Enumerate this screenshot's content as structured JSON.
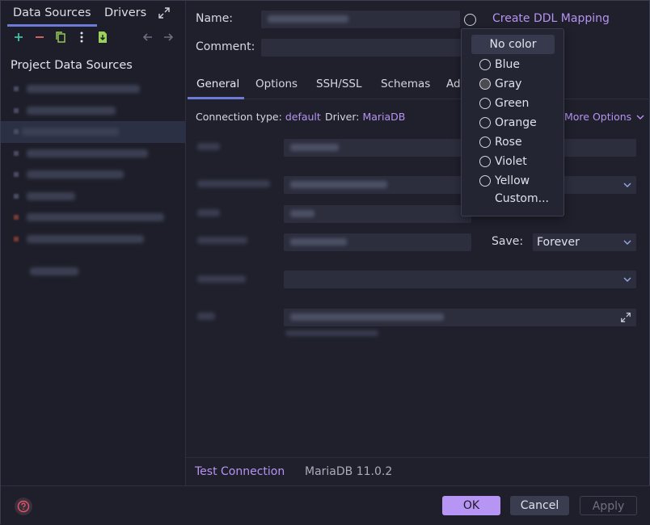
{
  "left_panel": {
    "tabs": [
      {
        "label": "Data Sources"
      },
      {
        "label": "Drivers"
      }
    ],
    "project_title": "Project Data Sources",
    "tree_rows": [
      {
        "w": 140
      },
      {
        "w": 110
      },
      {
        "w": 120
      },
      {
        "w": 150
      },
      {
        "w": 120
      },
      {
        "w": 60
      },
      {
        "w": 160
      },
      {
        "w": 140
      }
    ],
    "problems_row": {
      "w": 60
    }
  },
  "form": {
    "name_label": "Name:",
    "comment_label": "Comment:",
    "ddl_link": "Create DDL Mapping",
    "subtabs": [
      "General",
      "Options",
      "SSH/SSL",
      "Schemas",
      "Ad"
    ],
    "connection_type_label": "Connection type:",
    "connection_type_value": "default",
    "driver_label": "Driver:",
    "driver_value": "MariaDB",
    "more_options": "More Options",
    "save_label": "Save:",
    "save_value": "Forever"
  },
  "color_menu": {
    "no_color": "No color",
    "items": [
      "Blue",
      "Gray",
      "Green",
      "Orange",
      "Rose",
      "Violet",
      "Yellow"
    ],
    "custom": "Custom..."
  },
  "status": {
    "test_connection": "Test Connection",
    "version": "MariaDB 11.0.2"
  },
  "footer": {
    "ok": "OK",
    "cancel": "Cancel",
    "apply": "Apply"
  },
  "colors": {
    "accent": "#b793f0",
    "tab_underline": "#6c7cd6",
    "background": "#1f202c",
    "field": "#2c2e3e"
  }
}
